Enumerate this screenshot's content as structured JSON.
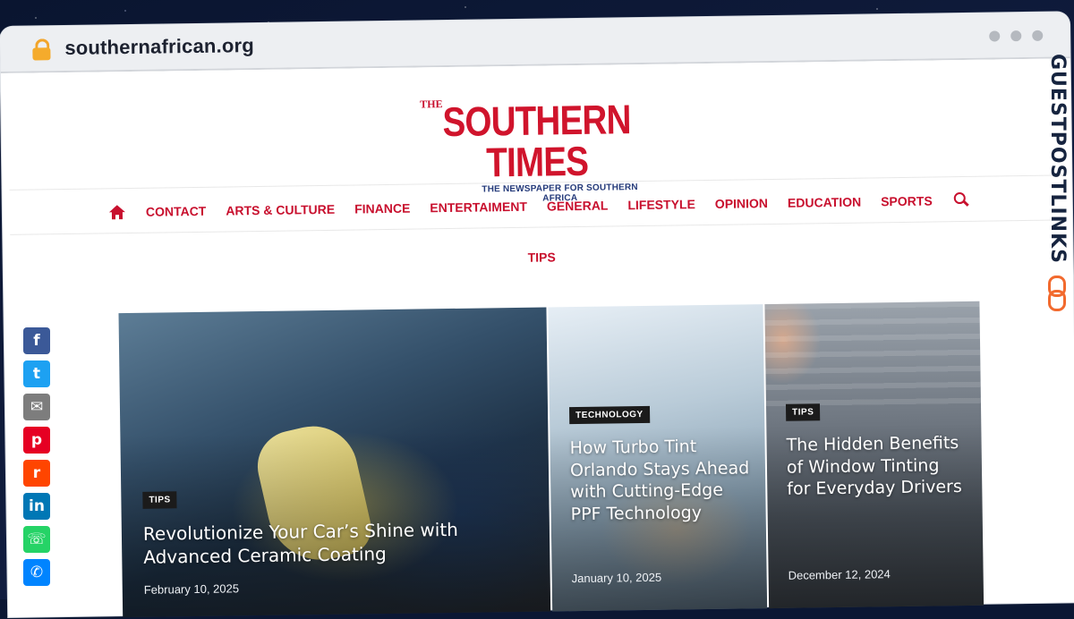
{
  "browser": {
    "url": "southernafrican.org"
  },
  "site": {
    "logo_the": "THE",
    "logo_name": "SOUTHERN TIMES",
    "logo_tagline": "THE NEWSPAPER FOR SOUTHERN AFRICA",
    "brand_color": "#c8102e"
  },
  "nav": {
    "items": [
      "CONTACT",
      "ARTS & CULTURE",
      "FINANCE",
      "ENTERTAIMENT",
      "GENERAL",
      "LIFESTYLE",
      "OPINION",
      "EDUCATION",
      "SPORTS"
    ],
    "second_row": "TIPS"
  },
  "articles": [
    {
      "tag": "TIPS",
      "title": "Revolutionize Your Car’s Shine with Advanced Ceramic Coating",
      "date": "February 10, 2025"
    },
    {
      "tag": "TECHNOLOGY",
      "title": "How Turbo Tint Orlando Stays Ahead with Cutting-Edge PPF Technology",
      "date": "January 10, 2025"
    },
    {
      "tag": "TIPS",
      "title": "The Hidden Benefits of Window Tinting for Everyday Drivers",
      "date": "December 12, 2024"
    }
  ],
  "social": [
    "facebook-icon",
    "twitter-icon",
    "email-icon",
    "pinterest-icon",
    "reddit-icon",
    "linkedin-icon",
    "whatsapp-icon",
    "messenger-icon"
  ],
  "watermark": "GUESTPOSTLINKS"
}
